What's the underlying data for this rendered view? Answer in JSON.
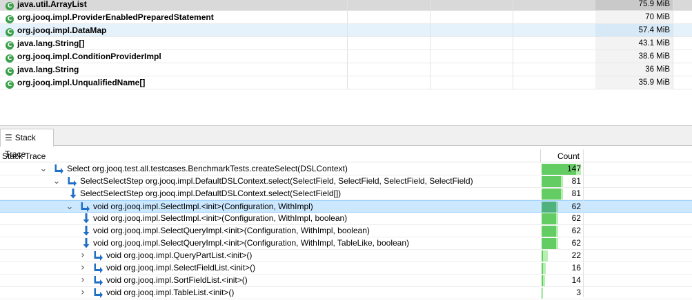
{
  "classes": [
    {
      "name": "java.util.ArrayList",
      "size": "75.9 MiB",
      "state": "selected"
    },
    {
      "name": "org.jooq.impl.ProviderEnabledPreparedStatement",
      "size": "70 MiB",
      "state": "normal"
    },
    {
      "name": "org.jooq.impl.DataMap",
      "size": "57.4 MiB",
      "state": "hover"
    },
    {
      "name": "java.lang.String[]",
      "size": "43.1 MiB",
      "state": "normal"
    },
    {
      "name": "org.jooq.impl.ConditionProviderImpl",
      "size": "38.6 MiB",
      "state": "normal"
    },
    {
      "name": "java.lang.String",
      "size": "36 MiB",
      "state": "normal"
    },
    {
      "name": "org.jooq.impl.UnqualifiedName[]",
      "size": "35.9 MiB",
      "state": "normal"
    }
  ],
  "class_icon_glyph": "C",
  "view_tab": {
    "label": "Stack Trace",
    "icon": "list-icon"
  },
  "tree": {
    "headers": {
      "stack": "Stack Trace",
      "count": "Count"
    },
    "max_count": 147,
    "rows": [
      {
        "depth": 0,
        "expander": "expanded",
        "icon": "caller-arrow",
        "label": "Select org.jooq.test.all.testcases.BenchmarkTests.createSelect(DSLContext)",
        "count": "147",
        "value": 147,
        "inner_value": 130,
        "selected": false
      },
      {
        "depth": 1,
        "expander": "expanded",
        "icon": "caller-arrow",
        "label": "SelectSelectStep org.jooq.impl.DefaultDSLContext.select(SelectField, SelectField, SelectField, SelectField)",
        "count": "81",
        "value": 81,
        "inner_value": 72,
        "selected": false
      },
      {
        "depth": 2,
        "expander": "none",
        "icon": "leaf-arrow",
        "label": "SelectSelectStep org.jooq.impl.DefaultDSLContext.select(SelectField[])",
        "count": "81",
        "value": 81,
        "inner_value": 72,
        "selected": false
      },
      {
        "depth": 2,
        "expander": "expanded",
        "icon": "caller-arrow",
        "label": "void org.jooq.impl.SelectImpl.<init>(Configuration, WithImpl)",
        "count": "62",
        "value": 62,
        "inner_value": 55,
        "selected": true
      },
      {
        "depth": 3,
        "expander": "none",
        "icon": "leaf-arrow",
        "label": "void org.jooq.impl.SelectImpl.<init>(Configuration, WithImpl, boolean)",
        "count": "62",
        "value": 62,
        "inner_value": 55,
        "selected": false
      },
      {
        "depth": 3,
        "expander": "none",
        "icon": "leaf-arrow",
        "label": "void org.jooq.impl.SelectQueryImpl.<init>(Configuration, WithImpl, boolean)",
        "count": "62",
        "value": 62,
        "inner_value": 55,
        "selected": false
      },
      {
        "depth": 3,
        "expander": "none",
        "icon": "leaf-arrow",
        "label": "void org.jooq.impl.SelectQueryImpl.<init>(Configuration, WithImpl, TableLike, boolean)",
        "count": "62",
        "value": 62,
        "inner_value": 55,
        "selected": false
      },
      {
        "depth": 3,
        "expander": "collapsed",
        "icon": "caller-arrow",
        "label": "void org.jooq.impl.QueryPartList.<init>()",
        "count": "22",
        "value": 22,
        "inner_value": 4,
        "selected": false
      },
      {
        "depth": 3,
        "expander": "collapsed",
        "icon": "caller-arrow",
        "label": "void org.jooq.impl.SelectFieldList.<init>()",
        "count": "16",
        "value": 16,
        "inner_value": 4,
        "selected": false
      },
      {
        "depth": 3,
        "expander": "collapsed",
        "icon": "caller-arrow",
        "label": "void org.jooq.impl.SortFieldList.<init>()",
        "count": "14",
        "value": 14,
        "inner_value": 4,
        "selected": false
      },
      {
        "depth": 3,
        "expander": "collapsed",
        "icon": "caller-arrow",
        "label": "void org.jooq.impl.TableList.<init>()",
        "count": "3",
        "value": 3,
        "inner_value": 1,
        "selected": false
      }
    ]
  },
  "colors": {
    "class_icon": "#3aa04a",
    "call_arrow": "#1f6fc5",
    "bar_light": "#b6f0b0",
    "bar_dark": "#63cc63",
    "selection": "#cce8ff"
  }
}
